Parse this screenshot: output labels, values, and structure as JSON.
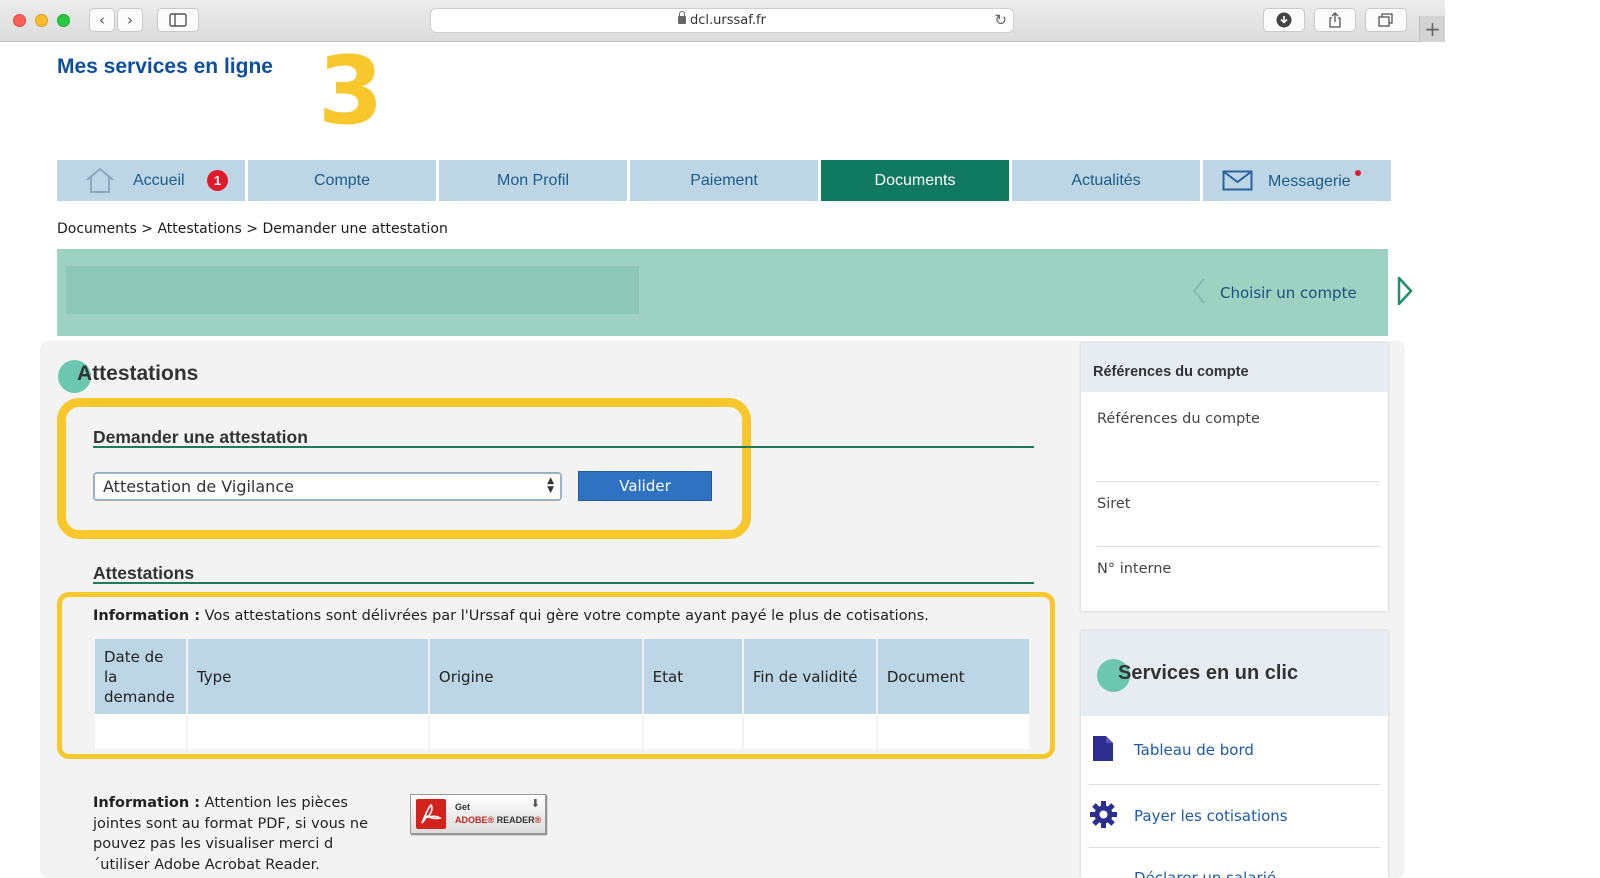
{
  "browser": {
    "url": "dcl.urssaf.fr",
    "nav_back": "‹",
    "nav_forward": "›",
    "new_tab": "+"
  },
  "header": {
    "site_title": "Mes services en ligne",
    "step_number": "3"
  },
  "nav": {
    "items": [
      {
        "label": "Accueil",
        "badge": "1"
      },
      {
        "label": "Compte"
      },
      {
        "label": "Mon Profil"
      },
      {
        "label": "Paiement"
      },
      {
        "label": "Documents",
        "active": true
      },
      {
        "label": "Actualités"
      },
      {
        "label": "Messagerie",
        "has_dot": true
      }
    ]
  },
  "breadcrumb": "Documents > Attestations > Demander une attestation",
  "banner": {
    "choose_account": "Choisir un compte"
  },
  "main": {
    "section_title": "Attestations",
    "request": {
      "title": "Demander une attestation",
      "select_value": "Attestation de Vigilance",
      "validate_label": "Valider"
    },
    "list": {
      "title": "Attestations",
      "info_label": "Information :",
      "info_text": " Vos attestations sont délivrées par l'Urssaf qui gère votre compte ayant payé le plus de cotisations.",
      "columns": [
        "Date de la demande",
        "Type",
        "Origine",
        "Etat",
        "Fin de validité",
        "Document"
      ]
    },
    "info2_label": "Information :",
    "info2_text": " Attention les pièces jointes sont au format PDF, si vous ne pouvez pas les visualiser merci d ´utiliser Adobe Acrobat Reader.",
    "adobe": {
      "get": "Get",
      "brand": "ADOBE",
      "reader": "READER"
    }
  },
  "sidebar": {
    "references": {
      "title": "Références du compte",
      "fields": [
        "Références du compte",
        "Siret",
        "N° interne"
      ]
    },
    "services": {
      "title": "Services en un clic",
      "items": [
        {
          "label": "Tableau de bord",
          "icon": "document-icon"
        },
        {
          "label": "Payer les cotisations",
          "icon": "gear-icon"
        },
        {
          "label": "Déclarer un salarié",
          "icon": "user-icon"
        }
      ]
    }
  },
  "colors": {
    "accent_green": "#0f7a60",
    "nav_blue": "#bcd6e6",
    "highlight_yellow": "#f7c72c",
    "banner_green": "#9dd1c2",
    "link_blue": "#1e5aa8"
  }
}
